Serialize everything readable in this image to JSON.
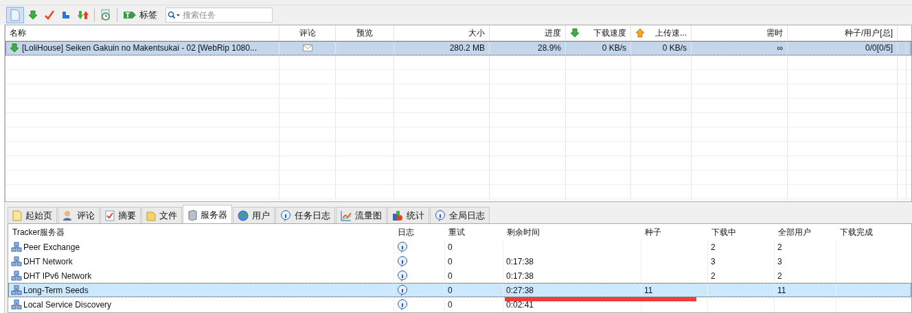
{
  "toolbar": {
    "tag_button": "标签",
    "search": {
      "placeholder": "搜索任务"
    }
  },
  "tasks": {
    "columns": [
      "名称",
      "评论",
      "预览",
      "大小",
      "进度",
      "下载速度",
      "上传速...",
      "需时",
      "种子/用户[总]"
    ],
    "rows": [
      {
        "selected": true,
        "cells": [
          "[LoliHouse] Seiken Gakuin no Makentsukai - 02 [WebRip 1080...",
          "",
          "",
          "280.2 MB",
          "28.9%",
          "0 KB/s",
          "0 KB/s",
          "∞",
          "0/0[0/5]"
        ]
      }
    ]
  },
  "detail_tabs": [
    {
      "label": "起始页",
      "selected": false
    },
    {
      "label": "评论",
      "selected": false
    },
    {
      "label": "摘要",
      "selected": false
    },
    {
      "label": "文件",
      "selected": false
    },
    {
      "label": "服务器",
      "selected": true
    },
    {
      "label": "用户",
      "selected": false
    },
    {
      "label": "任务日志",
      "selected": false
    },
    {
      "label": "流量图",
      "selected": false
    },
    {
      "label": "统计",
      "selected": false
    },
    {
      "label": "全局日志",
      "selected": false
    }
  ],
  "trackers": {
    "columns": [
      "Tracker服务器",
      "日志",
      "重试",
      "剩余时间",
      "种子",
      "下载中",
      "全部用户",
      "下载完成"
    ],
    "rows": [
      {
        "selected": false,
        "cells": [
          "Peer Exchange",
          "",
          "0",
          "",
          "",
          "2",
          "2",
          ""
        ]
      },
      {
        "selected": false,
        "cells": [
          "DHT Network",
          "",
          "0",
          "0:17:38",
          "",
          "3",
          "3",
          ""
        ]
      },
      {
        "selected": false,
        "cells": [
          "DHT IPv6 Network",
          "",
          "0",
          "0:17:38",
          "",
          "2",
          "2",
          ""
        ]
      },
      {
        "selected": true,
        "cells": [
          "Long-Term Seeds",
          "",
          "0",
          "0:27:38",
          "11",
          "",
          "11",
          ""
        ]
      },
      {
        "selected": false,
        "cells": [
          "Local Service Discovery",
          "",
          "0",
          "0:02:41",
          "",
          "",
          "",
          ""
        ]
      }
    ]
  }
}
